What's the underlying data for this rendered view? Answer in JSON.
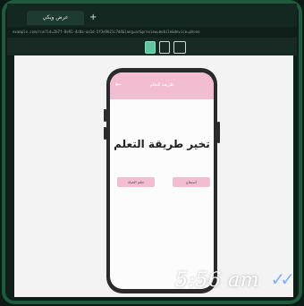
{
  "browser": {
    "tab_label": "عرض ويكي",
    "new_tab_symbol": "+",
    "address": "example.com/run?id=2b7f-8e91-4c0a-aa1d-5f3e9b21c7d4&lang=ar&preview=mobile&device=phone"
  },
  "device_toolbar": {
    "icons": [
      "phone-icon",
      "tablet-icon",
      "desktop-icon"
    ],
    "selected": "phone"
  },
  "app": {
    "appbar_title": "طريقة التعلم",
    "back_symbol": "←",
    "heading": "تخير طريقة التعلم",
    "buttons": {
      "right": "استماع",
      "left": "تعلم الحياة"
    },
    "accent_color": "#f2bdd1"
  },
  "overlay": {
    "time": "5:56 am",
    "ticks": "✓✓",
    "tick_color": "#7fb3ff"
  }
}
